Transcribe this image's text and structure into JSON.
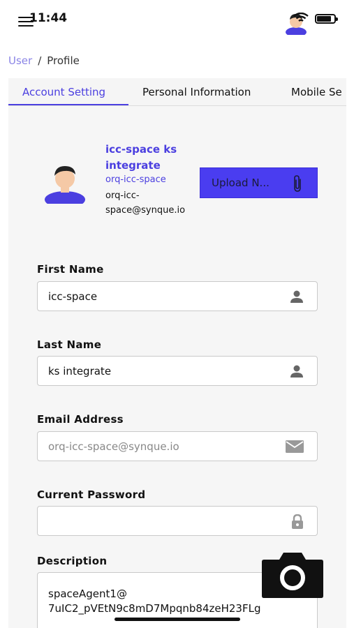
{
  "status_bar": {
    "time": "11:44"
  },
  "breadcrumb": {
    "parent": "User",
    "separator": "/",
    "current": "Profile"
  },
  "tabs": [
    {
      "label": "Account Setting",
      "active": true
    },
    {
      "label": "Personal Information",
      "active": false
    },
    {
      "label": "Mobile Se",
      "active": false
    }
  ],
  "profile": {
    "name": "icc-space ks integrate",
    "org": "orq-icc-space",
    "email": "orq-icc-space@synque.io",
    "upload_label": "Upload N..."
  },
  "form": {
    "first_name": {
      "label": "First Name",
      "value": "icc-space",
      "icon": "person-icon"
    },
    "last_name": {
      "label": "Last Name",
      "value": "ks integrate",
      "icon": "person-icon"
    },
    "email": {
      "label": "Email Address",
      "value": "orq-icc-space@synque.io",
      "icon": "mail-icon"
    },
    "current_password": {
      "label": "Current Password",
      "value": "",
      "icon": "lock-icon"
    },
    "description": {
      "label": "Description",
      "value": "spaceAgent1@ 7uIC2_pVEtN9c8mD7Mpqnb84zeH23FLg"
    }
  },
  "colors": {
    "accent": "#4b3fe0",
    "button": "#4a3df0",
    "link": "#8a84e6"
  }
}
